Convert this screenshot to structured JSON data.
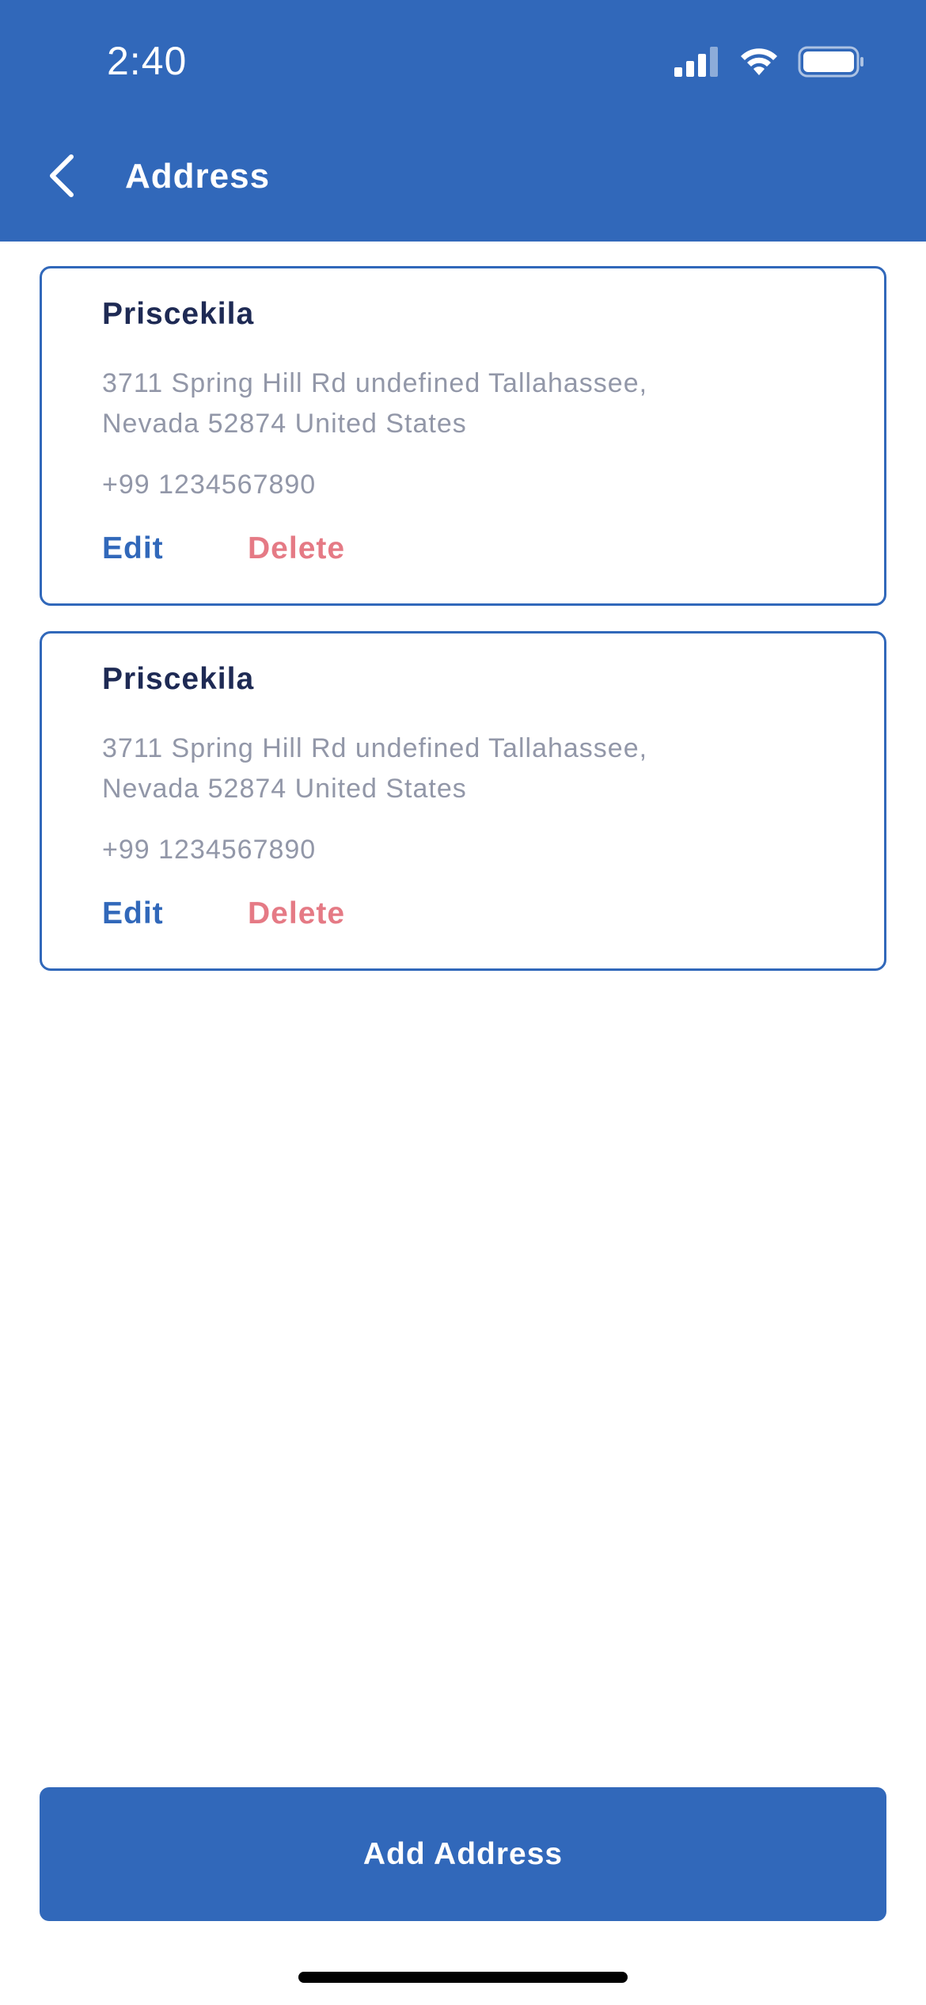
{
  "status_bar": {
    "time": "2:40",
    "icons": [
      "signal-icon",
      "wifi-icon",
      "battery-icon"
    ]
  },
  "header": {
    "title": "Address",
    "back_icon": "chevron-left-icon",
    "background_color": "#3168BA"
  },
  "addresses": [
    {
      "name": "Priscekila",
      "address_line_1": "3711 Spring Hill Rd undefined Tallahassee,",
      "address_line_2": "Nevada 52874 United States",
      "phone": "+99 1234567890",
      "edit_label": "Edit",
      "delete_label": "Delete"
    },
    {
      "name": "Priscekila",
      "address_line_1": "3711 Spring Hill Rd undefined Tallahassee,",
      "address_line_2": "Nevada 52874 United States",
      "phone": "+99 1234567890",
      "edit_label": "Edit",
      "delete_label": "Delete"
    }
  ],
  "footer": {
    "add_button_label": "Add Address"
  },
  "colors": {
    "primary": "#3168BA",
    "name_text": "#1E2A54",
    "secondary_text": "#9297A8",
    "delete": "#E57A85"
  }
}
